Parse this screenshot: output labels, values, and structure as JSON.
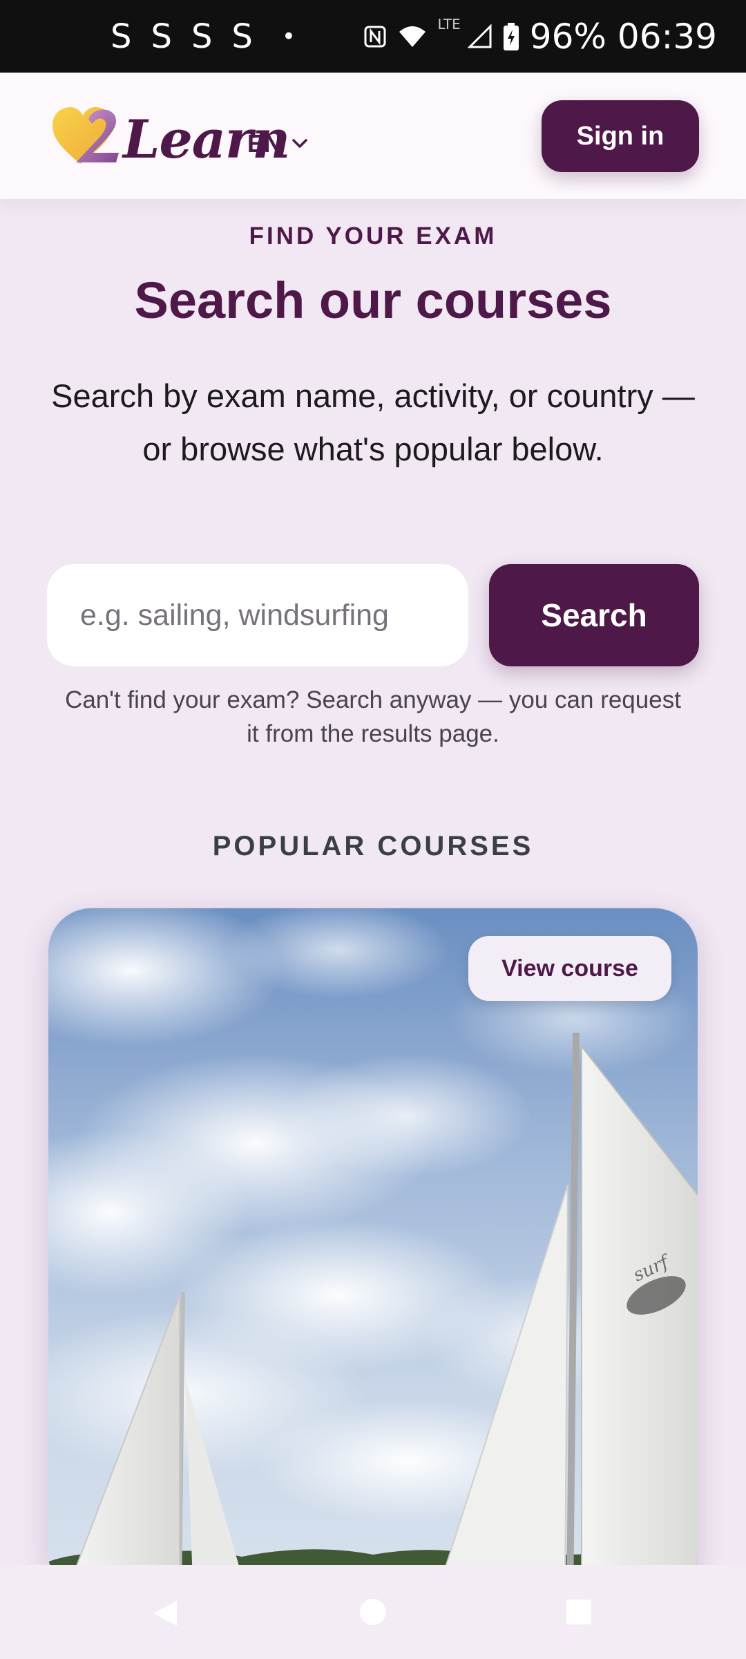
{
  "status_bar": {
    "notifications": [
      "S",
      "S",
      "S",
      "S"
    ],
    "dot": "•",
    "network_label": "LTE",
    "battery": "96%",
    "time": "06:39"
  },
  "header": {
    "logo_text": "Learn",
    "language": "EN",
    "sign_in_label": "Sign in"
  },
  "hero": {
    "eyebrow": "FIND YOUR EXAM",
    "title": "Search our courses",
    "subtitle": "Search by exam name, activity, or country — or browse what's popular below."
  },
  "search": {
    "placeholder": "e.g. sailing, windsurfing",
    "button_label": "Search",
    "hint": "Can't find your exam? Search anyway — you can request it from the results page."
  },
  "popular": {
    "section_title": "POPULAR COURSES",
    "cards": [
      {
        "action_label": "View course",
        "image": "sailboats-under-cloudy-sky"
      }
    ]
  },
  "colors": {
    "brand": "#4e1848",
    "background": "#f1e8f3",
    "header_bg": "#fcf8fc"
  },
  "nav_bar": {
    "icons": [
      "back-icon",
      "home-icon",
      "recents-icon"
    ]
  }
}
